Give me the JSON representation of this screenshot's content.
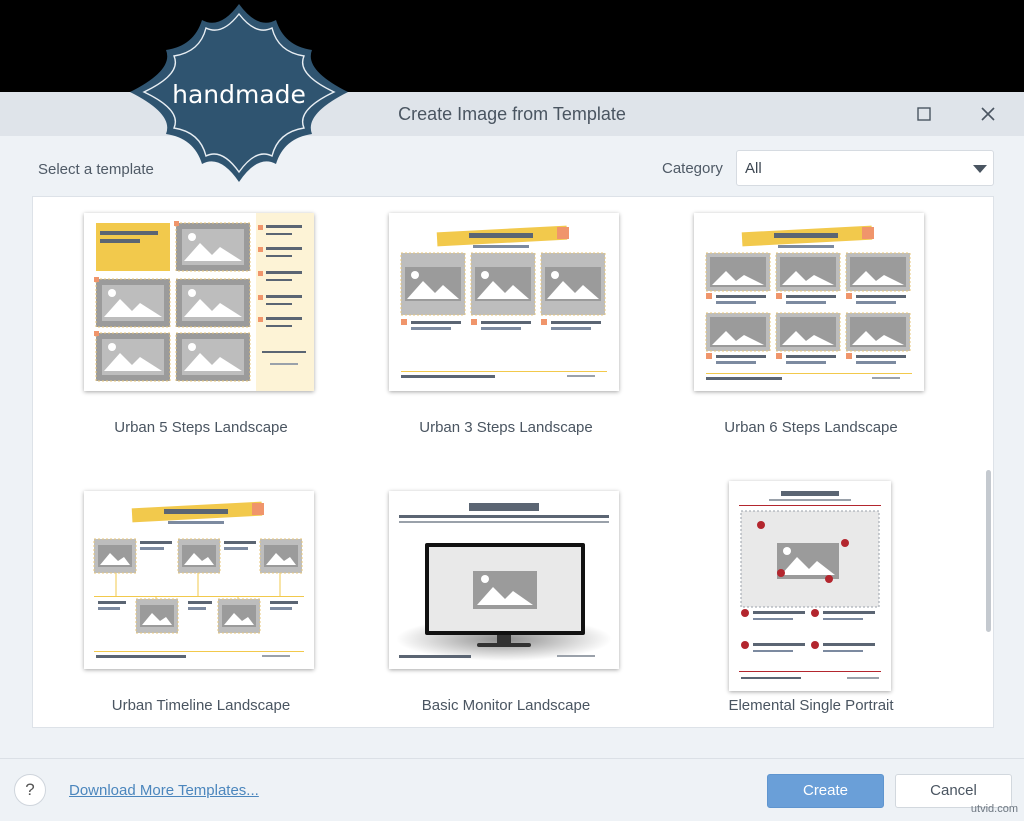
{
  "overlay_logo": {
    "text": "handmade"
  },
  "dialog": {
    "title": "Create Image from Template",
    "maximize_icon": "maximize-icon",
    "close_icon": "close-icon"
  },
  "filter": {
    "select_label": "Select a template",
    "category_label": "Category",
    "category_value": "All"
  },
  "templates": [
    {
      "label": "Urban 5 Steps Landscape",
      "thumbnail": "urban-5-steps-thumbnail"
    },
    {
      "label": "Urban 3 Steps Landscape",
      "thumbnail": "urban-3-steps-thumbnail"
    },
    {
      "label": "Urban 6 Steps Landscape",
      "thumbnail": "urban-6-steps-thumbnail"
    },
    {
      "label": "Urban Timeline Landscape",
      "thumbnail": "urban-timeline-thumbnail"
    },
    {
      "label": "Basic Monitor Landscape",
      "thumbnail": "basic-monitor-thumbnail"
    },
    {
      "label": "Elemental Single Portrait",
      "thumbnail": "elemental-single-thumbnail"
    }
  ],
  "footer": {
    "help_label": "?",
    "download_link": "Download More Templates...",
    "create_label": "Create",
    "cancel_label": "Cancel"
  },
  "watermark": "utvid.com",
  "colors": {
    "accent_yellow": "#f2c94c",
    "accent_orange": "#f0956b",
    "primary_button": "#6a9fd8",
    "logo_blue": "#2f5470",
    "elemental_red": "#b3262e"
  }
}
